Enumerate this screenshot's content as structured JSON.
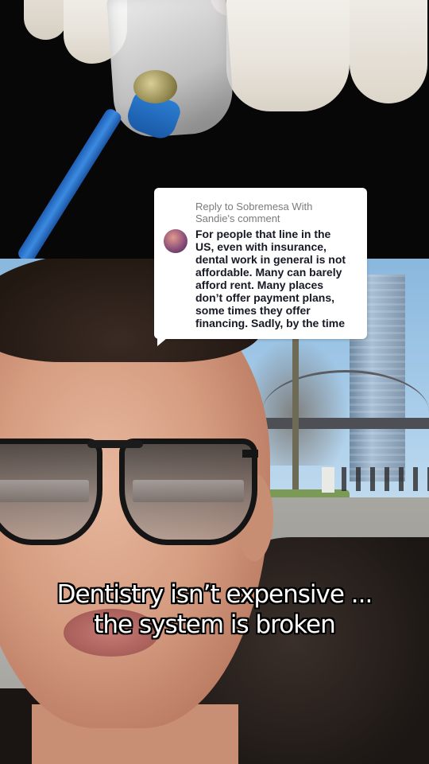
{
  "reply": {
    "header": "Reply to Sobremesa With\nSandie's comment",
    "comment": "For people that line in the\nUS, even with insurance,\ndental work in general is not\naffordable. Many can barely\nafford rent. Many places\ndon’t offer payment plans,\nsome times they offer\nfinancing. Sadly, by the time"
  },
  "caption": {
    "text": "Dentistry isn’t expensive ...\nthe system is broken"
  }
}
